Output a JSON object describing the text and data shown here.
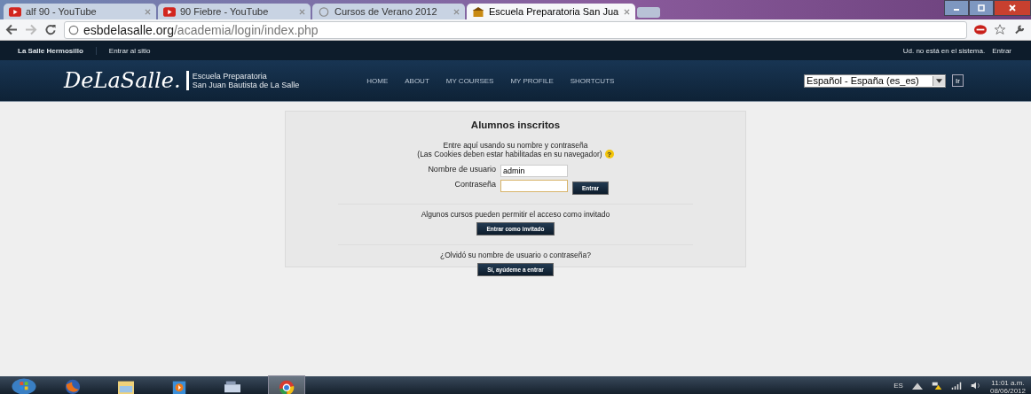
{
  "browser": {
    "tabs": [
      {
        "title": "alf 90 - YouTube",
        "kind": "video",
        "selected": false
      },
      {
        "title": "90 Fiebre - YouTube",
        "kind": "video",
        "selected": false
      },
      {
        "title": "Cursos de Verano 2012",
        "kind": "web",
        "selected": false
      },
      {
        "title": "Escuela Preparatoria San Jua",
        "kind": "school",
        "selected": true
      }
    ],
    "url_host": "esbdelasalle.org",
    "url_path": "/academia/login/index.php"
  },
  "breadcrumb": [
    "La Salle Hermosillo",
    "Entrar al sitio"
  ],
  "login_status": {
    "text": "Ud. no está en el sistema.",
    "link": "Entrar"
  },
  "header": {
    "logo": "DeLaSalle.",
    "school_line1": "Escuela Preparatoria",
    "school_line2": "San Juan Bautista de La Salle",
    "nav": [
      "HOME",
      "ABOUT",
      "MY COURSES",
      "MY PROFILE",
      "SHORTCUTS"
    ],
    "language": "Español - España (es_es)",
    "go_button": "Ir"
  },
  "login": {
    "title": "Alumnos inscritos",
    "intro1": "Entre aquí usando su nombre y contraseña",
    "intro2": "(Las Cookies deben estar habilitadas en su navegador)",
    "help_icon": "?",
    "username_label": "Nombre de usuario",
    "username_value": "admin",
    "password_label": "Contraseña",
    "submit": "Entrar",
    "guest_text": "Algunos cursos pueden permitir el acceso como invitado",
    "guest_button": "Entrar como invitado",
    "forgot_text": "¿Olvidó su nombre de usuario o contraseña?",
    "forgot_button": "Sí, ayúdeme a entrar"
  },
  "taskbar": {
    "apps": [
      {
        "kind": "firefox",
        "selected": false
      },
      {
        "kind": "folder",
        "selected": false
      },
      {
        "kind": "media",
        "selected": false
      },
      {
        "kind": "keyboard",
        "selected": false
      },
      {
        "kind": "chrome",
        "selected": true
      }
    ],
    "language": "ES",
    "time": "11:01 a.m.",
    "date": "08/06/2012"
  }
}
